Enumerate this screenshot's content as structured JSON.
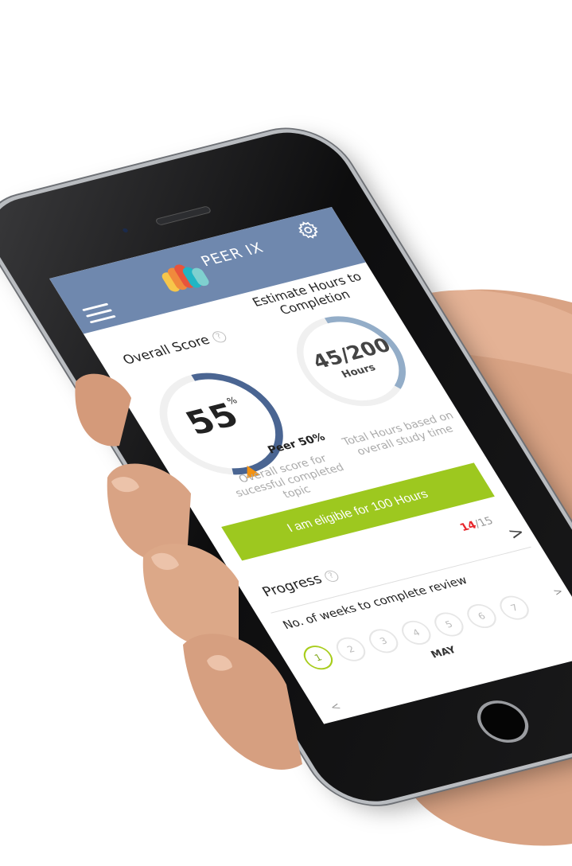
{
  "app": {
    "brand": "PEER IX"
  },
  "score": {
    "title": "Overall Score",
    "help": "?",
    "value": "55",
    "unit": "%",
    "fraction": 0.55,
    "peer_label": "Peer 50%",
    "peer_fraction": 0.5,
    "description": "Overall score for sucessful completed topic"
  },
  "hours": {
    "title": "Estimate Hours to Completion",
    "value": "45/200",
    "unit": "Hours",
    "done": 45,
    "total": 200,
    "description": "Total Hours based on overall study time"
  },
  "eligible_button": "I am eligible for 100 Hours",
  "progress": {
    "title": "Progress",
    "help": "?",
    "current": "14",
    "total": "/15",
    "next": ">",
    "weeks_label": "No. of weeks to complete review",
    "weeks": [
      "1",
      "2",
      "3",
      "4",
      "5",
      "6",
      "7"
    ],
    "active_week": 0,
    "month": "MAY",
    "prev": "<",
    "next_small": ">"
  },
  "colors": {
    "header": "#6f88ae",
    "score_arc": "#4a6592",
    "hours_arc": "#93adc8",
    "accent": "#9dc81f",
    "peer_marker": "#f39212",
    "count_red": "#e8252a"
  }
}
